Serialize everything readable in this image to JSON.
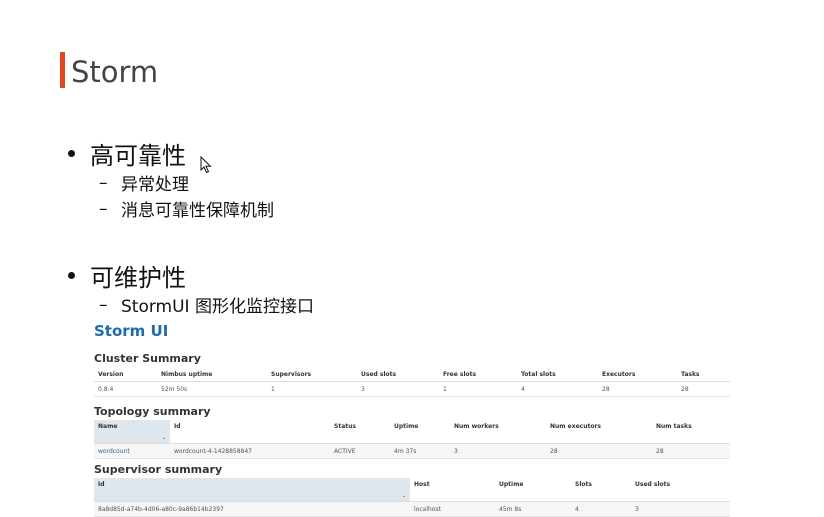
{
  "slide": {
    "title": "Storm",
    "bullets": [
      {
        "text": "高可靠性",
        "subs": [
          "异常处理",
          "消息可靠性保障机制"
        ]
      },
      {
        "text": "可维护性",
        "subs": [
          "StormUI 图形化监控接口"
        ]
      }
    ],
    "sub_dash": "–"
  },
  "storm_ui": {
    "title": "Storm UI",
    "cluster": {
      "title": "Cluster Summary",
      "headers": [
        "Version",
        "Nimbus uptime",
        "Supervisors",
        "Used slots",
        "Free slots",
        "Total slots",
        "Executors",
        "Tasks"
      ],
      "row": [
        "0.8.4",
        "52m 50s",
        "1",
        "3",
        "1",
        "4",
        "28",
        "28"
      ]
    },
    "topology": {
      "title": "Topology summary",
      "headers": [
        "Name",
        "Id",
        "Status",
        "Uptime",
        "Num workers",
        "Num executors",
        "Num tasks"
      ],
      "row": [
        "wordcount",
        "wordcount-4-1428858847",
        "ACTIVE",
        "4m 37s",
        "3",
        "28",
        "28"
      ]
    },
    "supervisor": {
      "title": "Supervisor summary",
      "headers": [
        "Id",
        "Host",
        "Uptime",
        "Slots",
        "Used slots"
      ],
      "row": [
        "8a8d85d-a74b-4d06-a80c-9a86b14b2397",
        "localhost",
        "45m 8s",
        "4",
        "3"
      ]
    },
    "sort_caret": "⌄"
  },
  "colors": {
    "accent_bar": "#e2461f",
    "storm_blue": "#1e6ca8",
    "sorted_header_bg": "#dfe7ee"
  }
}
